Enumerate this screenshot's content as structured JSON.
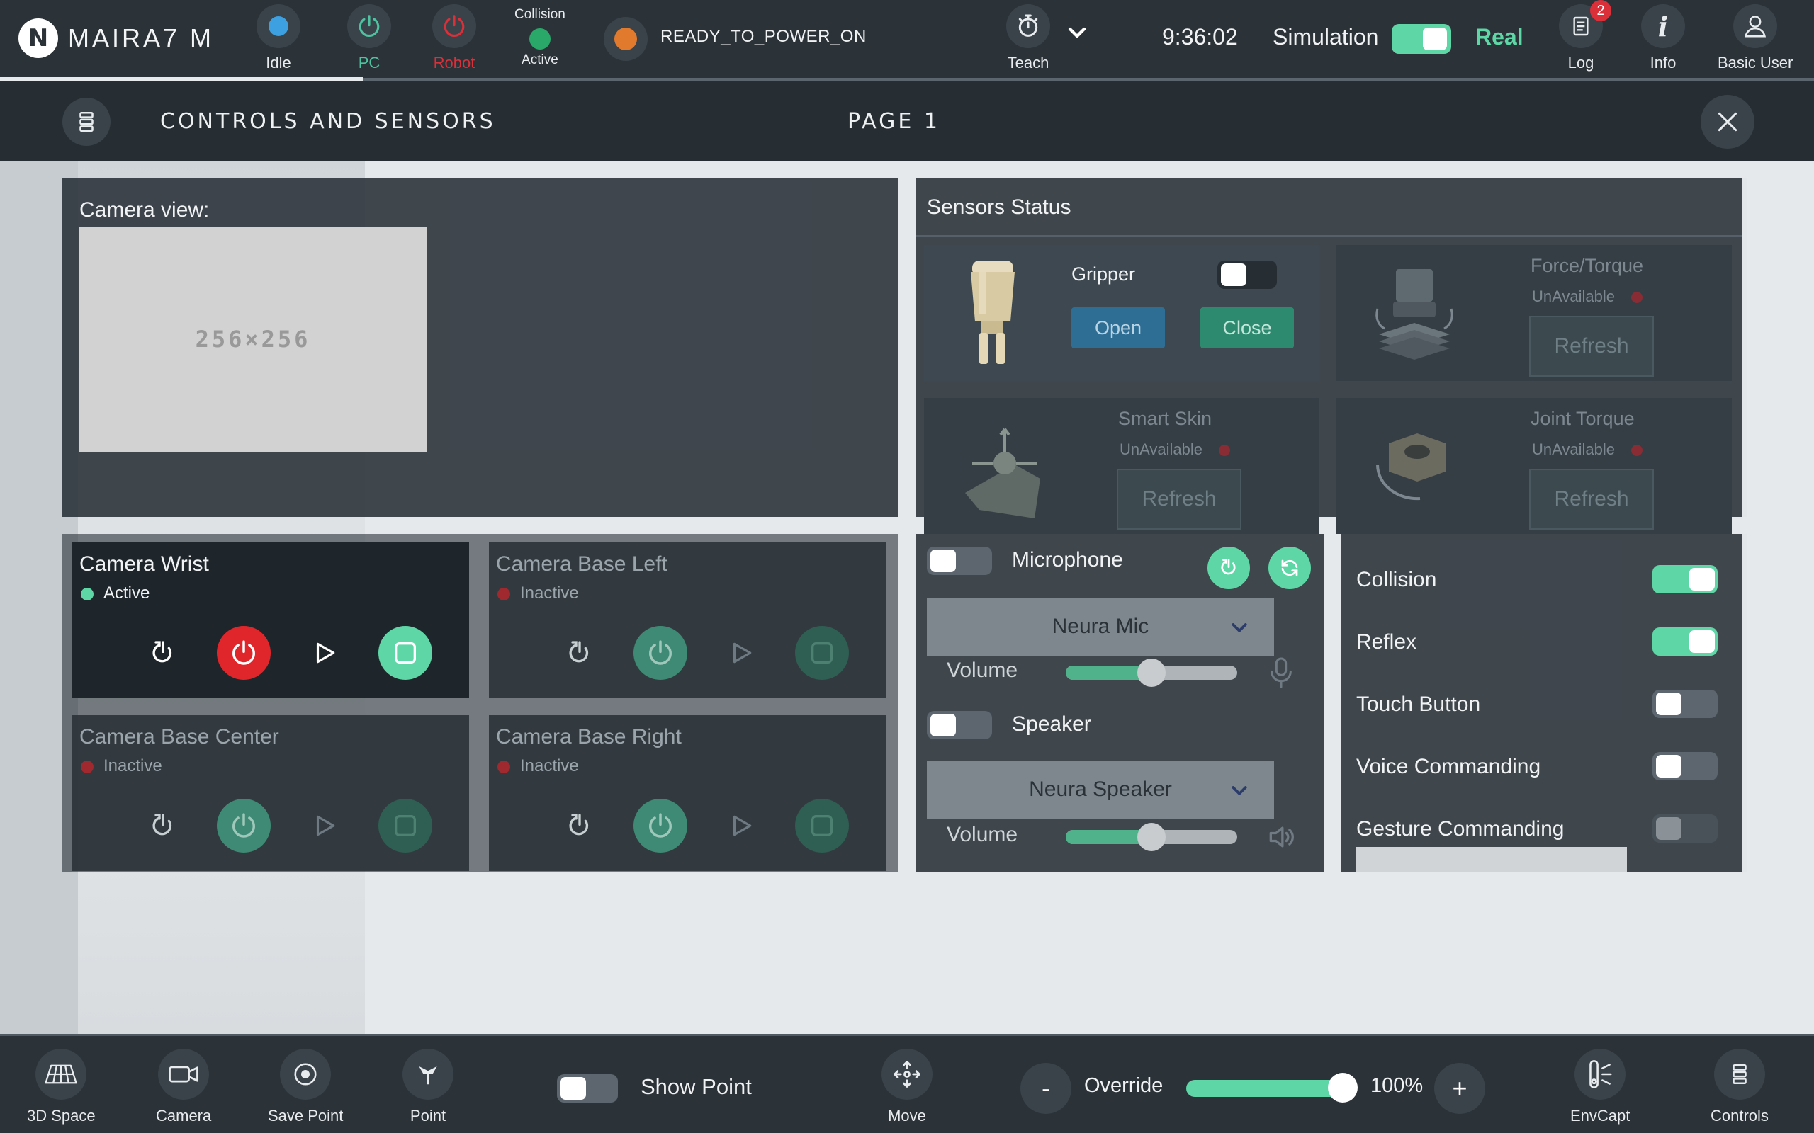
{
  "app": {
    "name": "MAIRA7 M",
    "logo_letter": "N"
  },
  "topbar": {
    "idle": {
      "label": "Idle",
      "color": "#3da0e0"
    },
    "pc": {
      "label": "PC",
      "color": "#4fc3a1"
    },
    "robot": {
      "label": "Robot",
      "color": "#d9303a"
    },
    "collision": {
      "title": "Collision",
      "state": "Active",
      "color": "#2aa86a"
    },
    "power_state": {
      "text": "READY_TO_POWER_ON",
      "color": "#e27a2e"
    },
    "teach": {
      "label": "Teach"
    },
    "clock": "9:36:02",
    "simulation_label": "Simulation",
    "mode_toggle_on": true,
    "real_label": "Real",
    "log": {
      "label": "Log",
      "badge": "2"
    },
    "info": {
      "label": "Info"
    },
    "user": {
      "label": "Basic User"
    }
  },
  "panel": {
    "title": "CONTROLS AND SENSORS",
    "page": "PAGE 1"
  },
  "camera_view": {
    "label": "Camera view:",
    "placeholder": "256×256"
  },
  "sensors": {
    "title": "Sensors Status",
    "gripper": {
      "name": "Gripper",
      "open": "Open",
      "close": "Close",
      "enabled": false
    },
    "force_torque": {
      "name": "Force/Torque",
      "status": "UnAvailable",
      "refresh": "Refresh"
    },
    "smart_skin": {
      "name": "Smart Skin",
      "status": "UnAvailable",
      "refresh": "Refresh"
    },
    "joint_torque": {
      "name": "Joint Torque",
      "status": "UnAvailable",
      "refresh": "Refresh"
    }
  },
  "cameras": [
    {
      "name": "Camera Wrist",
      "state": "Active",
      "active": true
    },
    {
      "name": "Camera Base Left",
      "state": "Inactive",
      "active": false
    },
    {
      "name": "Camera Base Center",
      "state": "Inactive",
      "active": false
    },
    {
      "name": "Camera Base Right",
      "state": "Inactive",
      "active": false
    }
  ],
  "audio": {
    "microphone": {
      "label": "Microphone",
      "enabled": false,
      "device": "Neura Mic",
      "volume_label": "Volume",
      "volume": 0.5
    },
    "speaker": {
      "label": "Speaker",
      "enabled": false,
      "device": "Neura Speaker",
      "volume_label": "Volume",
      "volume": 0.5
    }
  },
  "toggles": [
    {
      "label": "Collision",
      "on": true
    },
    {
      "label": "Reflex",
      "on": true
    },
    {
      "label": "Touch Button",
      "on": false
    },
    {
      "label": "Voice Commanding",
      "on": false
    },
    {
      "label": "Gesture Commanding",
      "on": false
    }
  ],
  "bottombar": {
    "space": "3D Space",
    "camera": "Camera",
    "save_point": "Save Point",
    "point": "Point",
    "show_point": "Show Point",
    "move": "Move",
    "minus": "-",
    "override_label": "Override",
    "override_value": "100%",
    "plus": "+",
    "envcapt": "EnvCapt",
    "controls": "Controls"
  },
  "colors": {
    "accent": "#5ed6a6",
    "danger": "#d9303a",
    "panel": "#283037"
  }
}
